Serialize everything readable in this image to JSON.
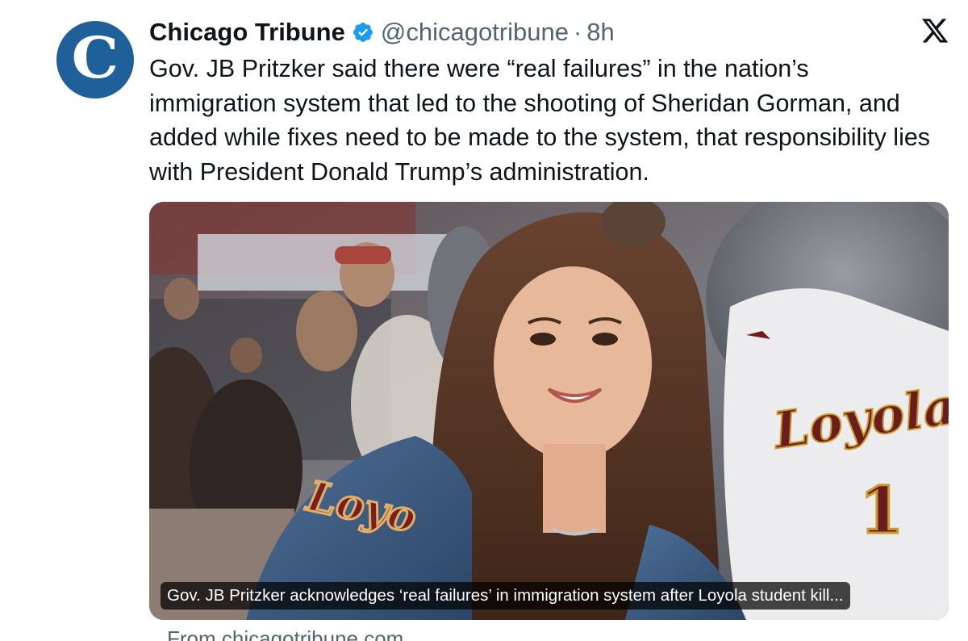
{
  "tweet": {
    "display_name": "Chicago Tribune",
    "handle": "@chicagotribune",
    "separator": "·",
    "time": "8h",
    "avatar_letter": "C",
    "text": "Gov. JB Pritzker said there were “real failures” in the nation’s immigration system that led to the shooting of Sheridan Gorman, and added while fixes need to be made to the system, that responsibility lies with President Donald Trump’s administration.",
    "verified_color": "#1d9bf0"
  },
  "card": {
    "caption": "Gov. JB Pritzker acknowledges ‘real failures’ in immigration system after Loyola student kill...",
    "source": "From chicagotribune.com",
    "photo_texts": {
      "jersey_text": "Loyola",
      "jersey_number": "1",
      "jacket_text": "Loyo"
    }
  },
  "icons": {
    "verified": "verified-badge-icon",
    "platform": "x-logo-icon"
  },
  "colors": {
    "avatar_bg": "#1f5f9a",
    "secondary_text": "#536471",
    "primary_text": "#0f1419",
    "jersey_maroon": "#6b1d1d",
    "jersey_gold": "#c99a2e"
  }
}
